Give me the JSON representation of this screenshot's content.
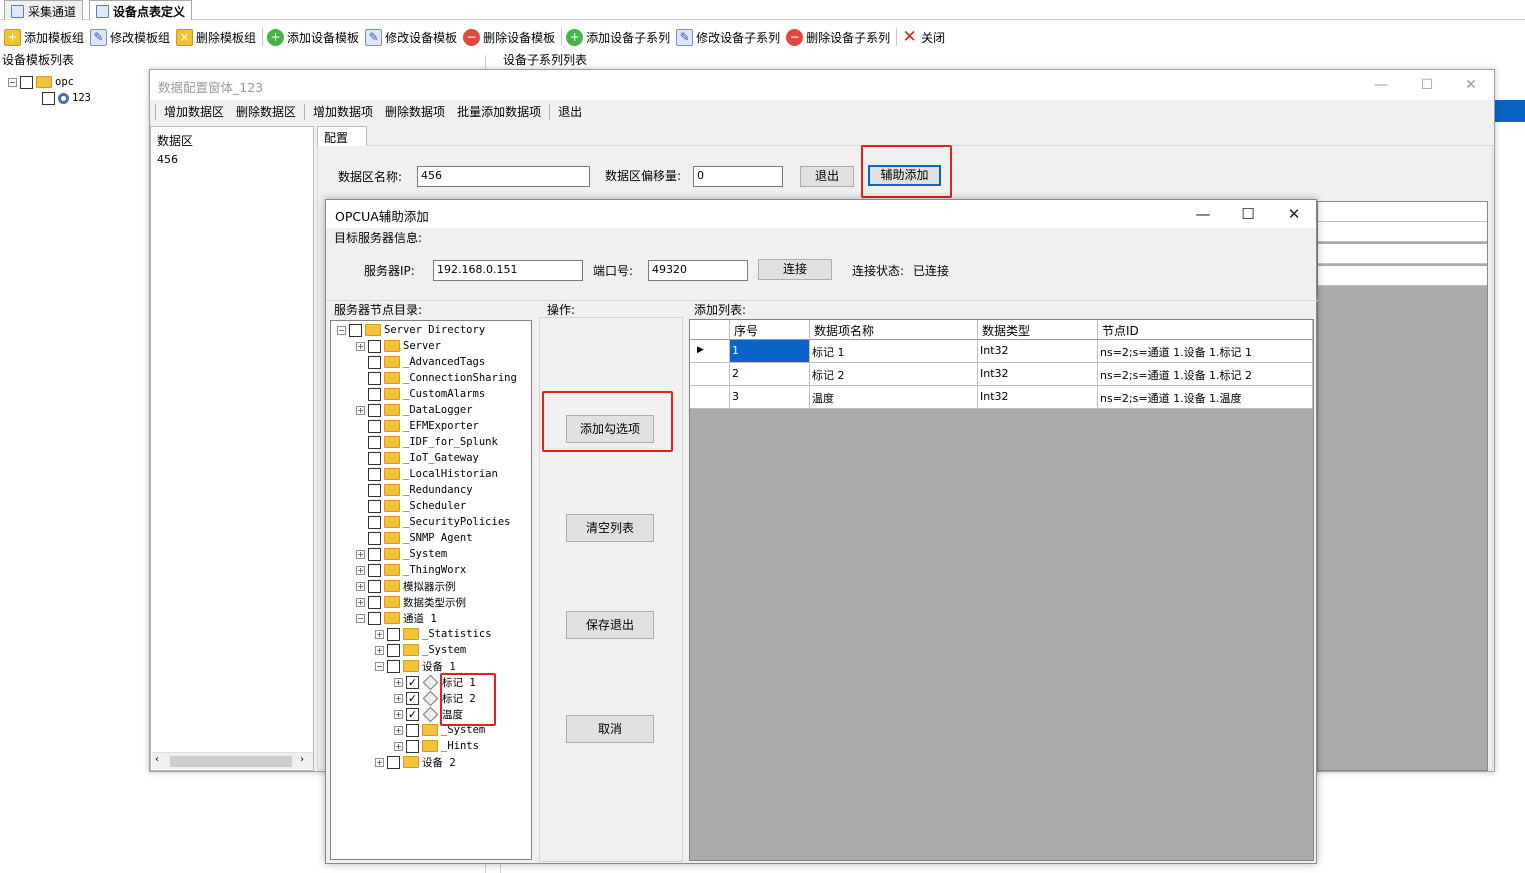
{
  "tabs": [
    {
      "label": "采集通道"
    },
    {
      "label": "设备点表定义"
    }
  ],
  "toolbar": {
    "items": [
      {
        "label": "添加模板组",
        "icon": "folder-add-icon"
      },
      {
        "label": "修改模板组",
        "icon": "edit-icon"
      },
      {
        "label": "删除模板组",
        "icon": "folder-delete-icon"
      },
      {
        "label": "添加设备模板",
        "icon": "add-icon"
      },
      {
        "label": "修改设备模板",
        "icon": "edit-icon"
      },
      {
        "label": "删除设备模板",
        "icon": "delete-icon"
      },
      {
        "label": "添加设备子系列",
        "icon": "add-icon"
      },
      {
        "label": "修改设备子系列",
        "icon": "edit-icon"
      },
      {
        "label": "删除设备子系列",
        "icon": "delete-icon"
      },
      {
        "label": "关闭",
        "icon": "close-icon"
      }
    ]
  },
  "left_section_label": "设备模板列表",
  "sub_section_label": "设备子系列列表",
  "left_tree": [
    {
      "label": "opc"
    },
    {
      "label": "123"
    }
  ],
  "data_window": {
    "title": "数据配置窗体_123",
    "menu": [
      "增加数据区",
      "删除数据区",
      "增加数据项",
      "删除数据项",
      "批量添加数据项",
      "退出"
    ],
    "list_header": "数据区",
    "list_items": [
      "456"
    ],
    "tab": "配置",
    "name_label": "数据区名称:",
    "name_value": "456",
    "offset_label": "数据区偏移量:",
    "offset_value": "0",
    "exit_button": "退出",
    "assist_button": "辅助添加"
  },
  "opcua": {
    "title": "OPCUA辅助添加",
    "server_info_label": "目标服务器信息:",
    "ip_label": "服务器IP:",
    "ip_value": "192.168.0.151",
    "port_label": "端口号:",
    "port_value": "49320",
    "connect_button": "连接",
    "status_label": "连接状态:",
    "status_value": "已连接",
    "tree_label": "服务器节点目录:",
    "ops_label": "操作:",
    "list_label": "添加列表:",
    "buttons": {
      "add_checked": "添加勾选项",
      "clear": "清空列表",
      "save_exit": "保存退出",
      "cancel": "取消"
    },
    "tree": [
      {
        "label": "Server Directory",
        "expander": "⊟"
      },
      {
        "label": "Server",
        "expander": "⊞"
      },
      {
        "label": "_AdvancedTags",
        "expander": ""
      },
      {
        "label": "_ConnectionSharing",
        "expander": ""
      },
      {
        "label": "_CustomAlarms",
        "expander": ""
      },
      {
        "label": "_DataLogger",
        "expander": "⊞"
      },
      {
        "label": "_EFMExporter",
        "expander": ""
      },
      {
        "label": "_IDF_for_Splunk",
        "expander": ""
      },
      {
        "label": "_IoT_Gateway",
        "expander": ""
      },
      {
        "label": "_LocalHistorian",
        "expander": ""
      },
      {
        "label": "_Redundancy",
        "expander": ""
      },
      {
        "label": "_Scheduler",
        "expander": ""
      },
      {
        "label": "_SecurityPolicies",
        "expander": ""
      },
      {
        "label": "_SNMP Agent",
        "expander": ""
      },
      {
        "label": "_System",
        "expander": "⊞"
      },
      {
        "label": "_ThingWorx",
        "expander": "⊞"
      },
      {
        "label": "模拟器示例",
        "expander": "⊞"
      },
      {
        "label": "数据类型示例",
        "expander": "⊞"
      },
      {
        "label": "通道 1",
        "expander": "⊟"
      },
      {
        "label": "_Statistics",
        "expander": "⊞"
      },
      {
        "label": "_System",
        "expander": "⊞"
      },
      {
        "label": "设备 1",
        "expander": "⊟"
      },
      {
        "label": "标记 1",
        "expander": "⊞",
        "checked": true,
        "type": "tag"
      },
      {
        "label": "标记 2",
        "expander": "⊞",
        "checked": true,
        "type": "tag"
      },
      {
        "label": "温度",
        "expander": "⊞",
        "checked": true,
        "type": "tag"
      },
      {
        "label": "_System",
        "expander": "⊞"
      },
      {
        "label": "_Hints",
        "expander": "⊞"
      },
      {
        "label": "设备 2",
        "expander": "⊞"
      }
    ],
    "grid": {
      "headers": [
        "序号",
        "数据项名称",
        "数据类型",
        "节点ID"
      ],
      "rows": [
        [
          "1",
          "标记 1",
          "Int32",
          "ns=2;s=通道 1.设备 1.标记 1"
        ],
        [
          "2",
          "标记 2",
          "Int32",
          "ns=2;s=通道 1.设备 1.标记 2"
        ],
        [
          "3",
          "温度",
          "Int32",
          "ns=2;s=通道 1.设备 1.温度"
        ]
      ]
    }
  }
}
